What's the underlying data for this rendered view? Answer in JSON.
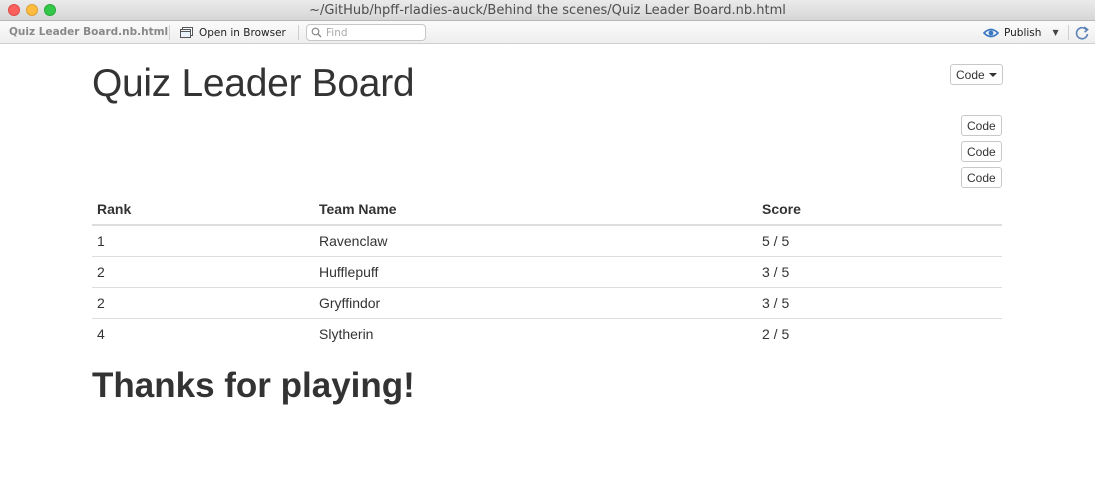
{
  "window": {
    "title": "~/GitHub/hpff-rladies-auck/Behind the scenes/Quiz Leader Board.nb.html"
  },
  "toolbar": {
    "file_name": "Quiz Leader Board.nb.html",
    "open_browser_label": "Open in Browser",
    "find_placeholder": "Find",
    "find_value": "",
    "publish_label": "Publish",
    "icons": [
      "open-in-browser-icon",
      "search-icon",
      "publish-icon",
      "dropdown-caret-icon",
      "refresh-icon"
    ]
  },
  "document": {
    "title": "Quiz Leader Board",
    "code_menu_label": "Code",
    "code_buttons": [
      "Code",
      "Code",
      "Code"
    ],
    "table": {
      "columns": [
        "Rank",
        "Team Name",
        "Score"
      ],
      "rows": [
        [
          "1",
          "Ravenclaw",
          "5 / 5"
        ],
        [
          "2",
          "Hufflepuff",
          "3 / 5"
        ],
        [
          "2",
          "Gryffindor",
          "3 / 5"
        ],
        [
          "4",
          "Slytherin",
          "2 / 5"
        ]
      ]
    },
    "closing_heading": "Thanks for playing!"
  }
}
